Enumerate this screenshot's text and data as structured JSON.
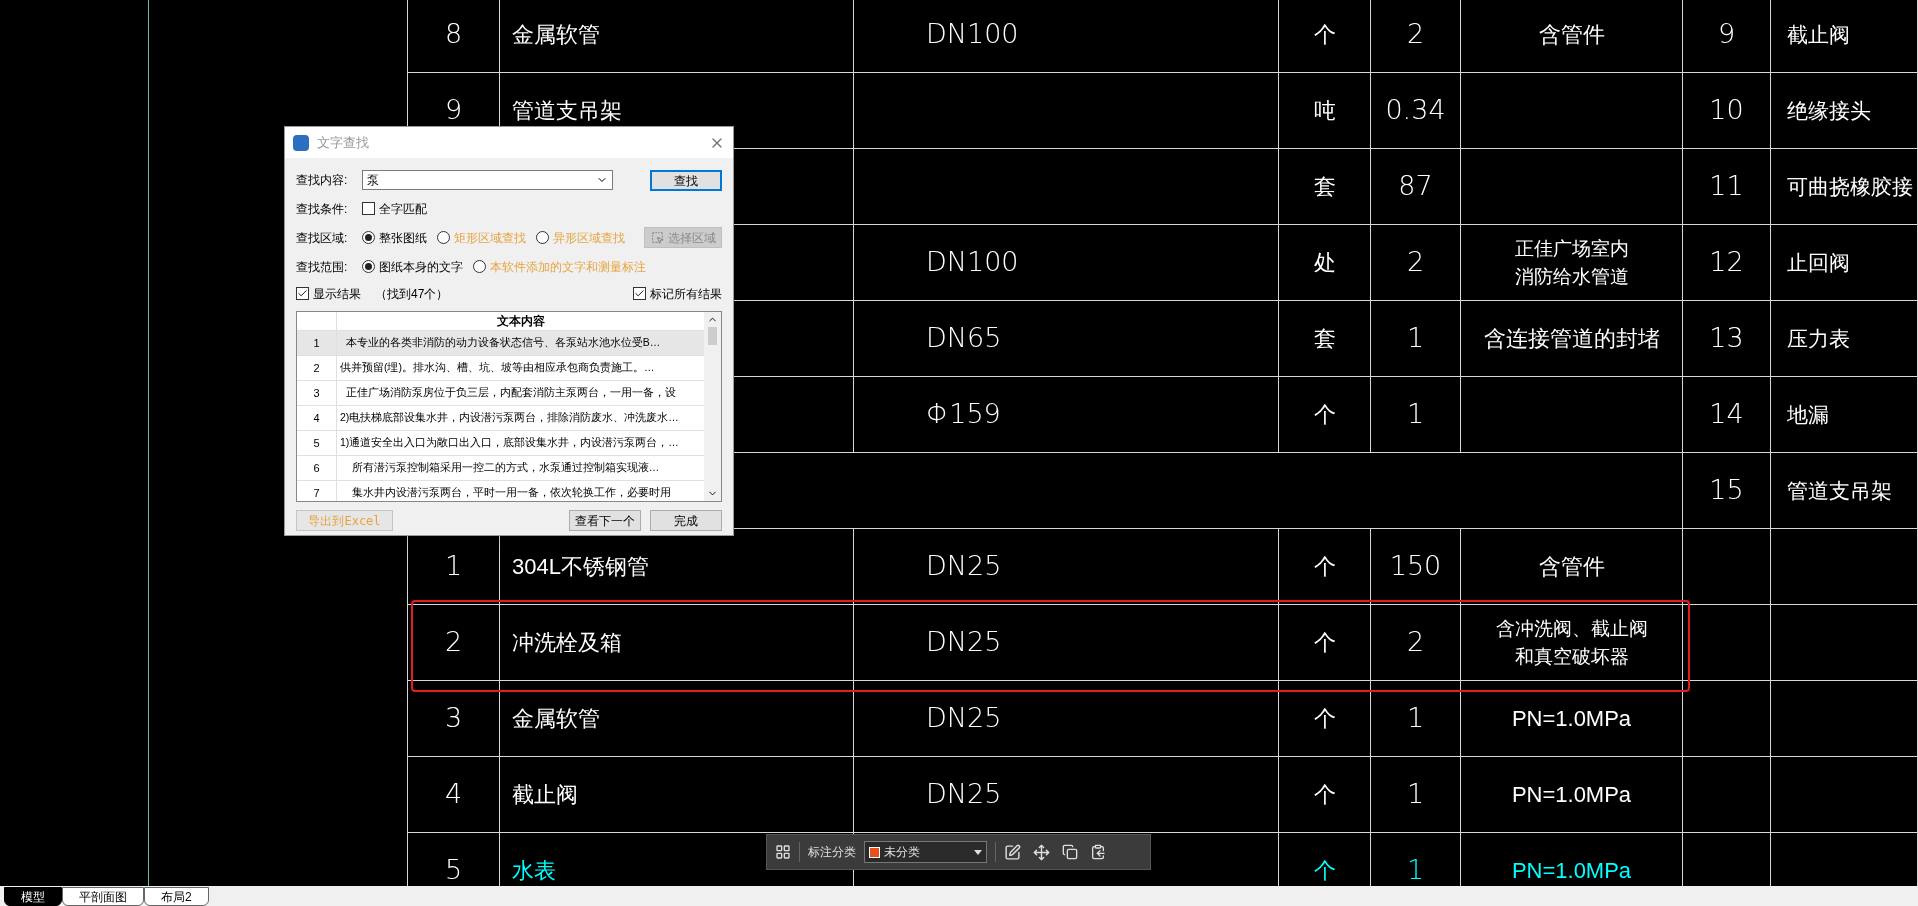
{
  "table": {
    "rows": [
      {
        "kind": "item",
        "no": "8",
        "name": "金属软管",
        "spec": "DN100",
        "unit": "个",
        "qty": "2",
        "remark": [
          "含管件"
        ],
        "no2": "9",
        "name2": "截止阀",
        "color": "#ffffff"
      },
      {
        "kind": "item",
        "no": "9",
        "name": "管道支吊架",
        "spec": "",
        "unit": "吨",
        "qty": "0.34",
        "remark": [],
        "no2": "10",
        "name2": "绝缘接头",
        "color": "#ffffff"
      },
      {
        "kind": "item",
        "no": "",
        "name": "",
        "spec": "",
        "unit": "套",
        "qty": "87",
        "remark": [],
        "no2": "11",
        "name2": "可曲挠橡胶接",
        "color": "#ffffff"
      },
      {
        "kind": "item",
        "no": "",
        "name": "",
        "spec": "DN100",
        "unit": "处",
        "qty": "2",
        "remark": [
          "正佳广场室内",
          "消防给水管道"
        ],
        "no2": "12",
        "name2": "止回阀",
        "color": "#ffffff"
      },
      {
        "kind": "item",
        "no": "",
        "name": "",
        "spec": "DN65",
        "unit": "套",
        "qty": "1",
        "remark": [
          "含连接管道的封堵"
        ],
        "no2": "13",
        "name2": "压力表",
        "color": "#ffffff"
      },
      {
        "kind": "item",
        "no": "",
        "name": "",
        "spec": "Φ159",
        "unit": "个",
        "qty": "1",
        "remark": [],
        "no2": "14",
        "name2": "地漏",
        "color": "#ffffff"
      },
      {
        "kind": "merged",
        "no2": "15",
        "name2": "管道支吊架"
      },
      {
        "kind": "item",
        "no": "1",
        "name": "304L不锈钢管",
        "spec": "DN25",
        "unit": "个",
        "qty": "150",
        "remark": [
          "含管件"
        ],
        "no2": "",
        "name2": "",
        "color": "#ffffff"
      },
      {
        "kind": "item",
        "no": "2",
        "name": "冲洗栓及箱",
        "spec": "DN25",
        "unit": "个",
        "qty": "2",
        "remark": [
          "含冲洗阀、截止阀",
          "和真空破坏器"
        ],
        "no2": "",
        "name2": "",
        "color": "#ffffff"
      },
      {
        "kind": "item",
        "no": "3",
        "name": "金属软管",
        "spec": "DN25",
        "unit": "个",
        "qty": "1",
        "remark": [
          "PN=1.0MPa"
        ],
        "no2": "",
        "name2": "",
        "color": "#ffffff"
      },
      {
        "kind": "item",
        "no": "4",
        "name": "截止阀",
        "spec": "DN25",
        "unit": "个",
        "qty": "1",
        "remark": [
          "PN=1.0MPa"
        ],
        "no2": "",
        "name2": "",
        "color": "#ffffff"
      },
      {
        "kind": "item",
        "no": "5",
        "name": "水表",
        "spec": "",
        "unit": "个",
        "qty": "1",
        "remark": [
          "PN=1.0MPa"
        ],
        "no2": "",
        "name2": "",
        "color": "#00ffff"
      }
    ]
  },
  "dialog": {
    "title": "文字查找",
    "content_label": "查找内容:",
    "query": "泵",
    "find_button": {
      "label": "查找",
      "default": true
    },
    "condition_label": "查找条件:",
    "whole_word": {
      "label": "全字匹配",
      "checked": false
    },
    "area_label": "查找区域:",
    "area_options": [
      {
        "label": "整张图纸",
        "selected": true,
        "kind": "plain"
      },
      {
        "label": "矩形区域查找",
        "selected": false,
        "kind": "highlighted"
      },
      {
        "label": "异形区域查找",
        "selected": false,
        "kind": "highlighted"
      }
    ],
    "select_area_button": {
      "label": "选择区域",
      "disabled": true
    },
    "scope_label": "查找范围:",
    "scope_options": [
      {
        "label": "图纸本身的文字",
        "selected": true,
        "kind": "plain"
      },
      {
        "label": "本软件添加的文字和测量标注",
        "selected": false,
        "kind": "highlighted"
      }
    ],
    "show_results": {
      "label": "显示结果",
      "checked": true
    },
    "found_count": "（找到47个）",
    "mark_all": {
      "label": "标记所有结果",
      "checked": true
    },
    "results": {
      "header": "文本内容",
      "rows": [
        {
          "no": "1",
          "text": "  本专业的各类非消防的动力设备状态信号、各泵站水池水位受B…",
          "selected": true
        },
        {
          "no": "2",
          "text": "供并预留(埋)。排水沟、槽、坑、坡等由相应承包商负责施工。…",
          "selected": false
        },
        {
          "no": "3",
          "text": "  正佳广场消防泵房位于负三层，内配套消防主泵两台，一用一备，设",
          "selected": false
        },
        {
          "no": "4",
          "text": "2)电扶梯底部设集水井，内设潜污泵两台，排除消防废水、冲洗废水…",
          "selected": false
        },
        {
          "no": "5",
          "text": "1)通道安全出入口为敞口出入口，底部设集水井，内设潜污泵两台，…",
          "selected": false
        },
        {
          "no": "6",
          "text": "    所有潜污泵控制箱采用一控二的方式，水泵通过控制箱实现液…",
          "selected": false
        },
        {
          "no": "7",
          "text": "    集水井内设潜污泵两台，平时一用一备，依次轮换工作，必要时用",
          "selected": false
        }
      ]
    },
    "export_button": {
      "label": "导出到Excel",
      "disabled": true
    },
    "next_button": "查看下一个",
    "done_button": "完成"
  },
  "toolbar": {
    "label": "标注分类",
    "category": {
      "label": "未分类",
      "color": "#e8501e"
    }
  },
  "tabs": [
    {
      "label": "模型",
      "selected": true
    },
    {
      "label": "平剖面图",
      "selected": false
    },
    {
      "label": "布局2",
      "selected": false
    }
  ]
}
